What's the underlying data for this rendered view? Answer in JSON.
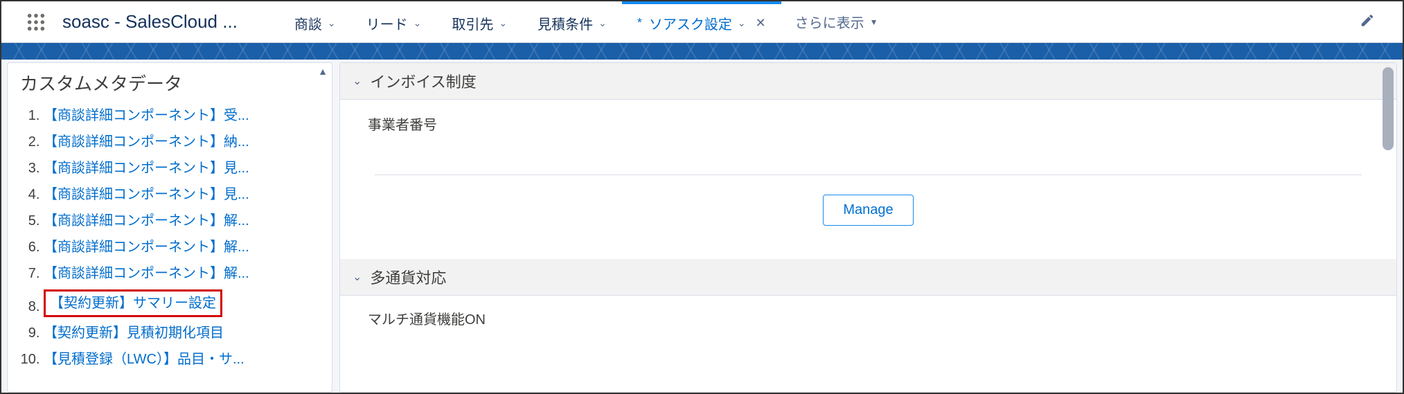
{
  "header": {
    "app_title": "soasc - SalesCloud ...",
    "tabs": [
      {
        "label": "商談"
      },
      {
        "label": "リード"
      },
      {
        "label": "取引先"
      },
      {
        "label": "見積条件"
      }
    ],
    "active_tab": {
      "label": "ソアスク設定",
      "unsaved_marker": "*"
    },
    "more_label": "さらに表示"
  },
  "sidebar": {
    "title": "カスタムメタデータ",
    "items": [
      {
        "label": "【商談詳細コンポーネント】受..."
      },
      {
        "label": "【商談詳細コンポーネント】納..."
      },
      {
        "label": "【商談詳細コンポーネント】見..."
      },
      {
        "label": "【商談詳細コンポーネント】見..."
      },
      {
        "label": "【商談詳細コンポーネント】解..."
      },
      {
        "label": "【商談詳細コンポーネント】解..."
      },
      {
        "label": "【商談詳細コンポーネント】解..."
      },
      {
        "label": "【契約更新】サマリー設定",
        "highlighted": true
      },
      {
        "label": "【契約更新】見積初期化項目"
      },
      {
        "label": "【見積登録（LWC）】品目・サ..."
      }
    ]
  },
  "content": {
    "section1": {
      "title": "インボイス制度",
      "field_label": "事業者番号",
      "manage_button": "Manage"
    },
    "section2": {
      "title": "多通貨対応",
      "field_label": "マルチ通貨機能ON"
    }
  }
}
